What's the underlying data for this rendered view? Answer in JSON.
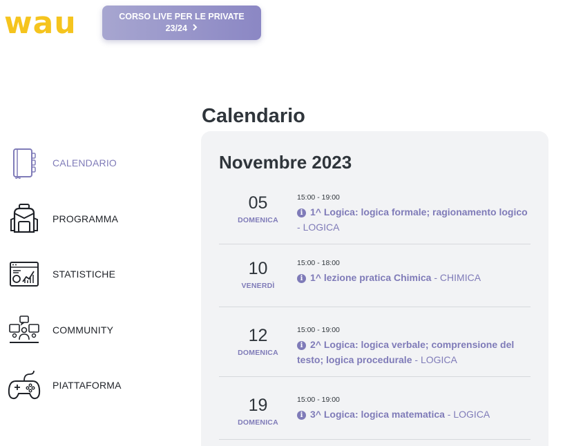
{
  "header": {
    "logo_text": "wau",
    "course_button": {
      "line1": "CORSO LIVE PER LE PRIVATE",
      "line2": "23/24",
      "icon": "chevron-right-icon"
    }
  },
  "sidebar": {
    "items": [
      {
        "label": "CALENDARIO",
        "icon": "planner-icon",
        "active": true
      },
      {
        "label": "PROGRAMMA",
        "icon": "backpack-icon",
        "active": false
      },
      {
        "label": "STATISTICHE",
        "icon": "stats-monitor-icon",
        "active": false
      },
      {
        "label": "COMMUNITY",
        "icon": "community-icon",
        "active": false
      },
      {
        "label": "PIATTAFORMA",
        "icon": "gamepad-icon",
        "active": false
      }
    ]
  },
  "main": {
    "title": "Calendario",
    "month": "Novembre 2023",
    "events": [
      {
        "day": "05",
        "weekday": "DOMENICA",
        "time": "15:00 - 19:00",
        "title": "1^ Logica: logica formale; ragionamento logico",
        "separator": " - ",
        "subject": "LOGICA"
      },
      {
        "day": "10",
        "weekday": "VENERDÌ",
        "time": "15:00 - 18:00",
        "title": "1^ lezione pratica Chimica",
        "separator": " - ",
        "subject": "CHIMICA"
      },
      {
        "day": "12",
        "weekday": "DOMENICA",
        "time": "15:00 - 19:00",
        "title": "2^ Logica: logica verbale; comprensione del testo; logica procedurale",
        "separator": " - ",
        "subject": "LOGICA"
      },
      {
        "day": "19",
        "weekday": "DOMENICA",
        "time": "15:00 - 19:00",
        "title": "3^ Logica: logica matematica",
        "separator": " - ",
        "subject": "LOGICA"
      }
    ]
  },
  "colors": {
    "accent": "#7f7bb8",
    "logo": "#f5c41e",
    "card_bg": "#f2f3f5",
    "button_gradient_start": "#a7a6d0",
    "button_gradient_end": "#8b87c4"
  }
}
